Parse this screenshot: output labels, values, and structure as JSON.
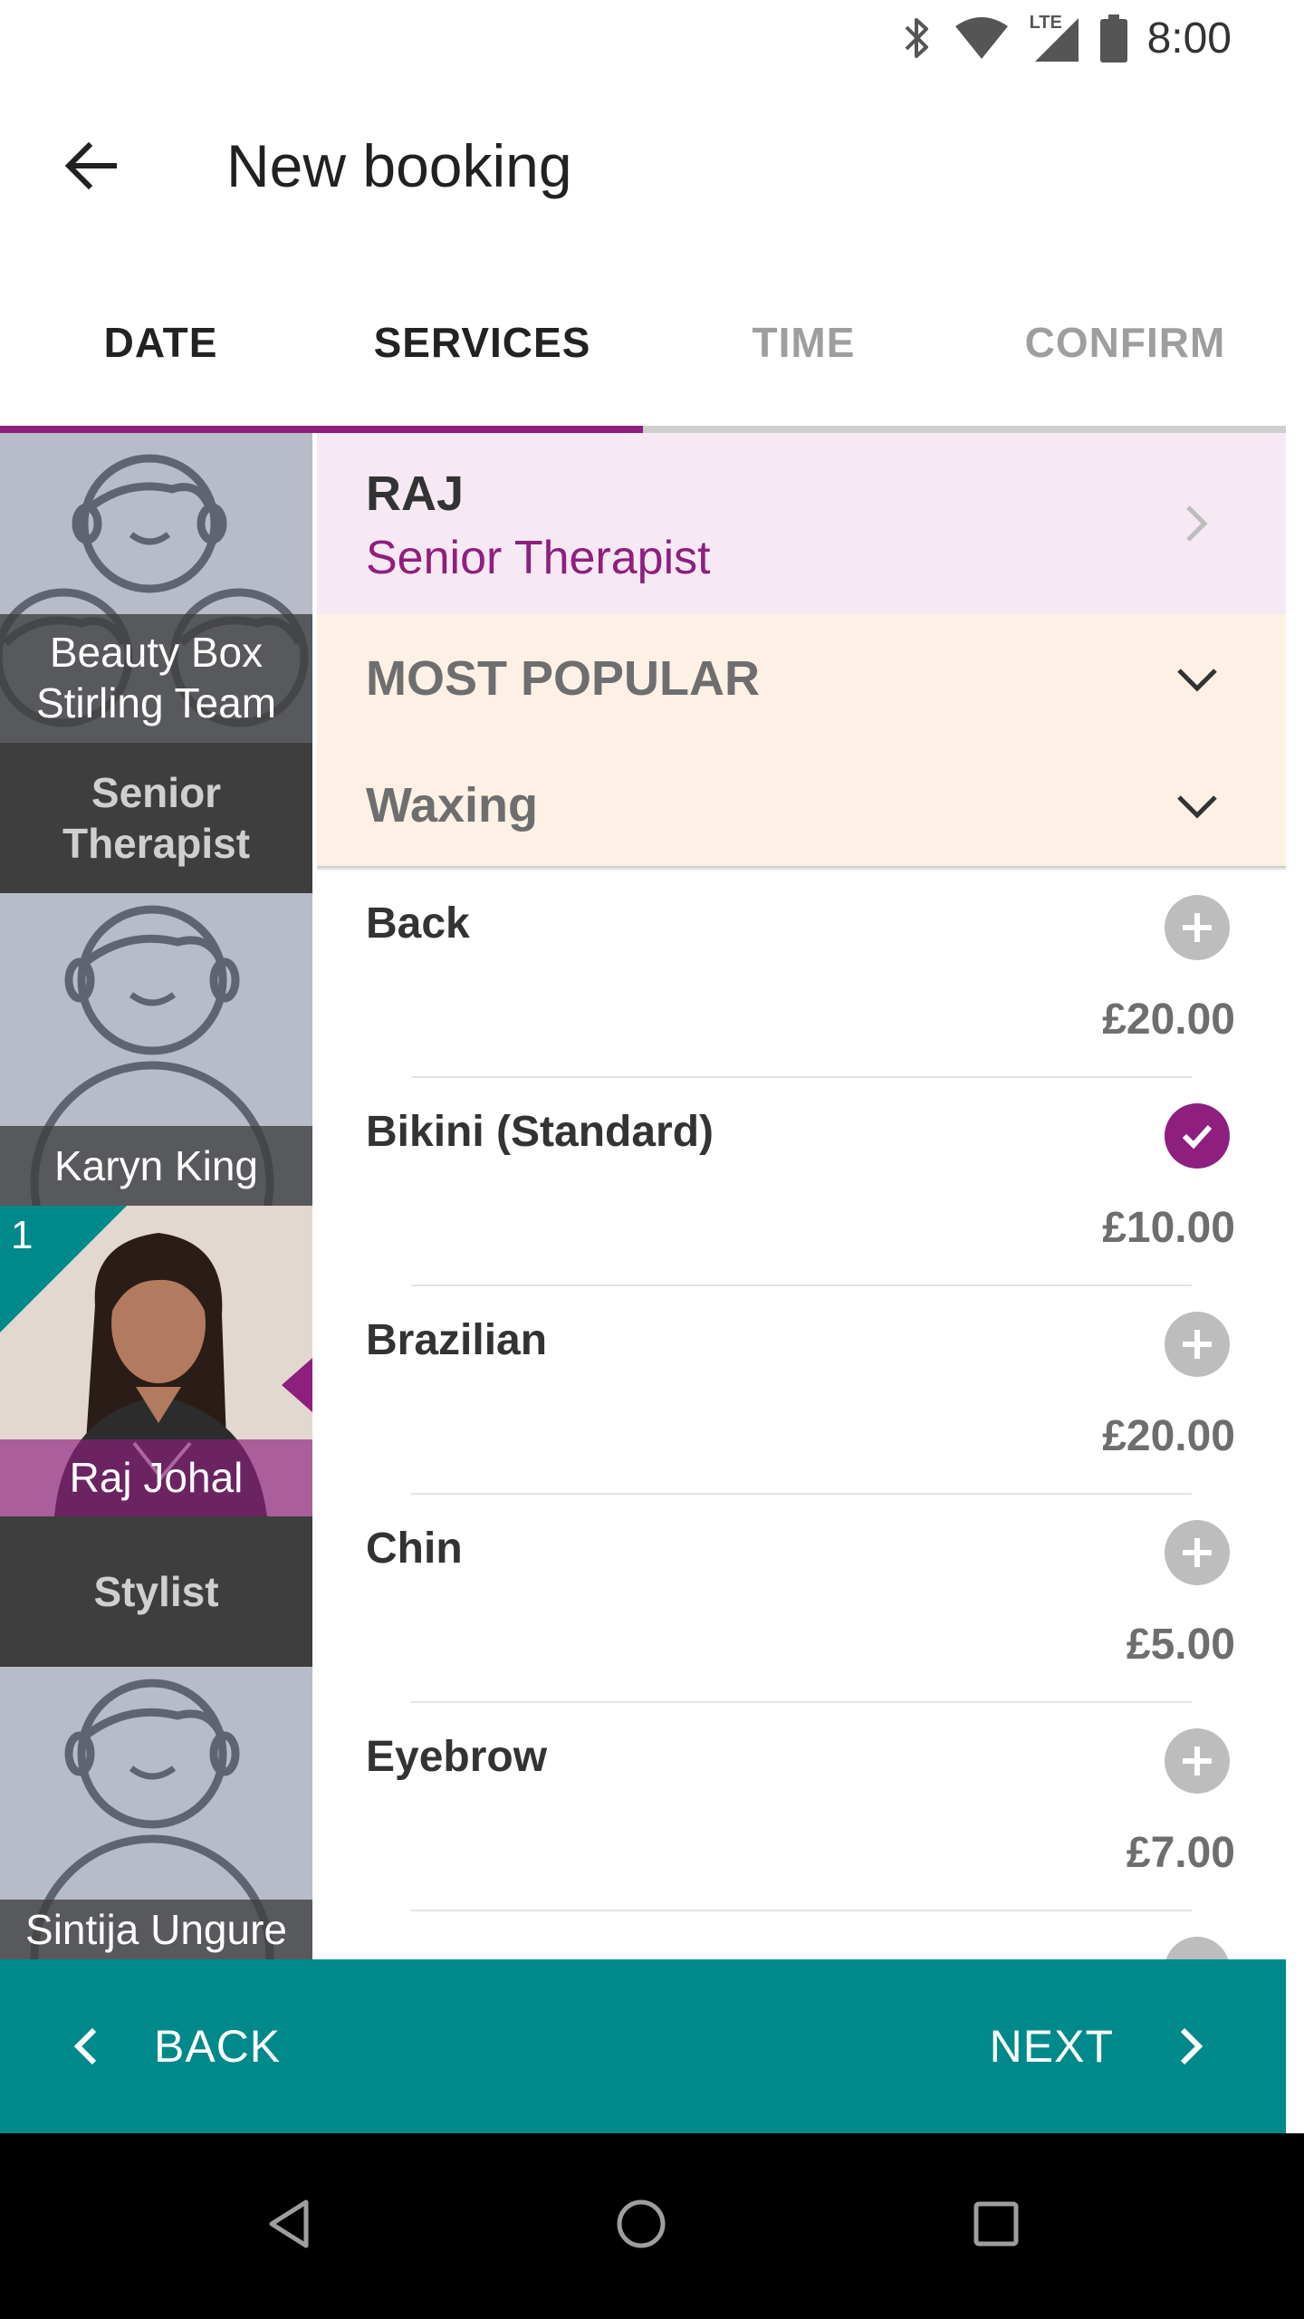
{
  "status_bar": {
    "time": "8:00",
    "icons": [
      "bluetooth-icon",
      "wifi-icon",
      "lte-signal-icon",
      "battery-icon"
    ],
    "network_label": "LTE"
  },
  "app_bar": {
    "title": "New booking",
    "back_icon": "arrow-left-icon"
  },
  "tabs": [
    {
      "label": "DATE",
      "state": "completed"
    },
    {
      "label": "SERVICES",
      "state": "active"
    },
    {
      "label": "TIME",
      "state": "inactive"
    },
    {
      "label": "CONFIRM",
      "state": "inactive"
    }
  ],
  "staff": {
    "team": {
      "name": "Beauty Box Stirling Team"
    },
    "groups": [
      {
        "role": "Senior Therapist",
        "members": [
          {
            "name": "Karyn King"
          },
          {
            "name": "Raj Johal",
            "selected": true,
            "badge": "1"
          }
        ]
      },
      {
        "role": "Stylist",
        "members": [
          {
            "name": "Sintija Ungure"
          }
        ]
      }
    ]
  },
  "therapist_header": {
    "name": "RAJ",
    "role": "Senior Therapist"
  },
  "categories": [
    {
      "label": "MOST POPULAR"
    },
    {
      "label": "Waxing"
    }
  ],
  "services": [
    {
      "name": "Back",
      "price": "£20.00",
      "selected": false
    },
    {
      "name": "Bikini (Standard)",
      "price": "£10.00",
      "selected": true
    },
    {
      "name": "Brazilian",
      "price": "£20.00",
      "selected": false
    },
    {
      "name": "Chin",
      "price": "£5.00",
      "selected": false
    },
    {
      "name": "Eyebrow",
      "price": "£7.00",
      "selected": false
    }
  ],
  "bottom_nav": {
    "back_label": "BACK",
    "next_label": "NEXT"
  },
  "colors": {
    "brand_purple": "#8e1f7e",
    "teal": "#00898a",
    "therapist_bg": "#f7e9f4",
    "category_bg": "#fdf1e5"
  }
}
